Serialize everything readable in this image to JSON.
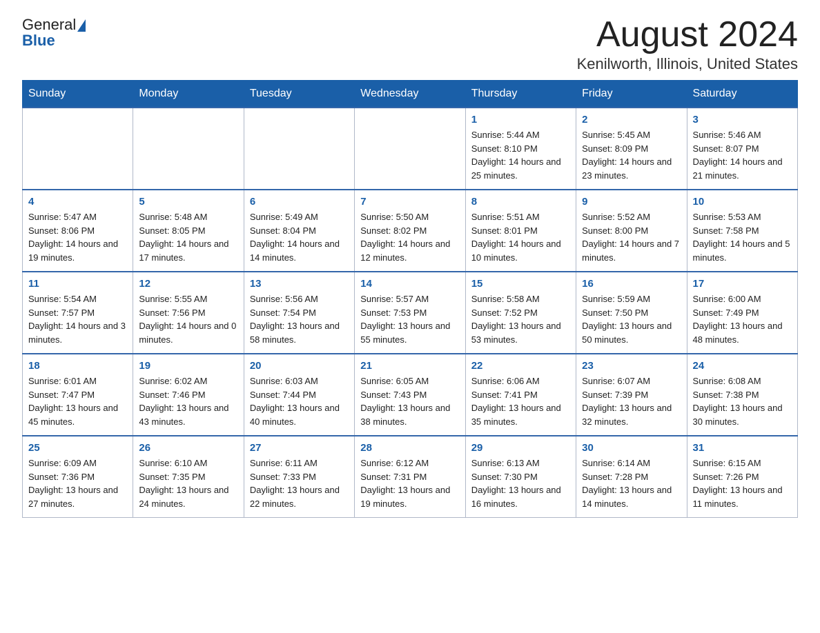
{
  "header": {
    "logo_general": "General",
    "logo_blue": "Blue",
    "month_year": "August 2024",
    "location": "Kenilworth, Illinois, United States"
  },
  "weekdays": [
    "Sunday",
    "Monday",
    "Tuesday",
    "Wednesday",
    "Thursday",
    "Friday",
    "Saturday"
  ],
  "weeks": [
    [
      {
        "day": "",
        "info": ""
      },
      {
        "day": "",
        "info": ""
      },
      {
        "day": "",
        "info": ""
      },
      {
        "day": "",
        "info": ""
      },
      {
        "day": "1",
        "info": "Sunrise: 5:44 AM\nSunset: 8:10 PM\nDaylight: 14 hours and 25 minutes."
      },
      {
        "day": "2",
        "info": "Sunrise: 5:45 AM\nSunset: 8:09 PM\nDaylight: 14 hours and 23 minutes."
      },
      {
        "day": "3",
        "info": "Sunrise: 5:46 AM\nSunset: 8:07 PM\nDaylight: 14 hours and 21 minutes."
      }
    ],
    [
      {
        "day": "4",
        "info": "Sunrise: 5:47 AM\nSunset: 8:06 PM\nDaylight: 14 hours and 19 minutes."
      },
      {
        "day": "5",
        "info": "Sunrise: 5:48 AM\nSunset: 8:05 PM\nDaylight: 14 hours and 17 minutes."
      },
      {
        "day": "6",
        "info": "Sunrise: 5:49 AM\nSunset: 8:04 PM\nDaylight: 14 hours and 14 minutes."
      },
      {
        "day": "7",
        "info": "Sunrise: 5:50 AM\nSunset: 8:02 PM\nDaylight: 14 hours and 12 minutes."
      },
      {
        "day": "8",
        "info": "Sunrise: 5:51 AM\nSunset: 8:01 PM\nDaylight: 14 hours and 10 minutes."
      },
      {
        "day": "9",
        "info": "Sunrise: 5:52 AM\nSunset: 8:00 PM\nDaylight: 14 hours and 7 minutes."
      },
      {
        "day": "10",
        "info": "Sunrise: 5:53 AM\nSunset: 7:58 PM\nDaylight: 14 hours and 5 minutes."
      }
    ],
    [
      {
        "day": "11",
        "info": "Sunrise: 5:54 AM\nSunset: 7:57 PM\nDaylight: 14 hours and 3 minutes."
      },
      {
        "day": "12",
        "info": "Sunrise: 5:55 AM\nSunset: 7:56 PM\nDaylight: 14 hours and 0 minutes."
      },
      {
        "day": "13",
        "info": "Sunrise: 5:56 AM\nSunset: 7:54 PM\nDaylight: 13 hours and 58 minutes."
      },
      {
        "day": "14",
        "info": "Sunrise: 5:57 AM\nSunset: 7:53 PM\nDaylight: 13 hours and 55 minutes."
      },
      {
        "day": "15",
        "info": "Sunrise: 5:58 AM\nSunset: 7:52 PM\nDaylight: 13 hours and 53 minutes."
      },
      {
        "day": "16",
        "info": "Sunrise: 5:59 AM\nSunset: 7:50 PM\nDaylight: 13 hours and 50 minutes."
      },
      {
        "day": "17",
        "info": "Sunrise: 6:00 AM\nSunset: 7:49 PM\nDaylight: 13 hours and 48 minutes."
      }
    ],
    [
      {
        "day": "18",
        "info": "Sunrise: 6:01 AM\nSunset: 7:47 PM\nDaylight: 13 hours and 45 minutes."
      },
      {
        "day": "19",
        "info": "Sunrise: 6:02 AM\nSunset: 7:46 PM\nDaylight: 13 hours and 43 minutes."
      },
      {
        "day": "20",
        "info": "Sunrise: 6:03 AM\nSunset: 7:44 PM\nDaylight: 13 hours and 40 minutes."
      },
      {
        "day": "21",
        "info": "Sunrise: 6:05 AM\nSunset: 7:43 PM\nDaylight: 13 hours and 38 minutes."
      },
      {
        "day": "22",
        "info": "Sunrise: 6:06 AM\nSunset: 7:41 PM\nDaylight: 13 hours and 35 minutes."
      },
      {
        "day": "23",
        "info": "Sunrise: 6:07 AM\nSunset: 7:39 PM\nDaylight: 13 hours and 32 minutes."
      },
      {
        "day": "24",
        "info": "Sunrise: 6:08 AM\nSunset: 7:38 PM\nDaylight: 13 hours and 30 minutes."
      }
    ],
    [
      {
        "day": "25",
        "info": "Sunrise: 6:09 AM\nSunset: 7:36 PM\nDaylight: 13 hours and 27 minutes."
      },
      {
        "day": "26",
        "info": "Sunrise: 6:10 AM\nSunset: 7:35 PM\nDaylight: 13 hours and 24 minutes."
      },
      {
        "day": "27",
        "info": "Sunrise: 6:11 AM\nSunset: 7:33 PM\nDaylight: 13 hours and 22 minutes."
      },
      {
        "day": "28",
        "info": "Sunrise: 6:12 AM\nSunset: 7:31 PM\nDaylight: 13 hours and 19 minutes."
      },
      {
        "day": "29",
        "info": "Sunrise: 6:13 AM\nSunset: 7:30 PM\nDaylight: 13 hours and 16 minutes."
      },
      {
        "day": "30",
        "info": "Sunrise: 6:14 AM\nSunset: 7:28 PM\nDaylight: 13 hours and 14 minutes."
      },
      {
        "day": "31",
        "info": "Sunrise: 6:15 AM\nSunset: 7:26 PM\nDaylight: 13 hours and 11 minutes."
      }
    ]
  ]
}
